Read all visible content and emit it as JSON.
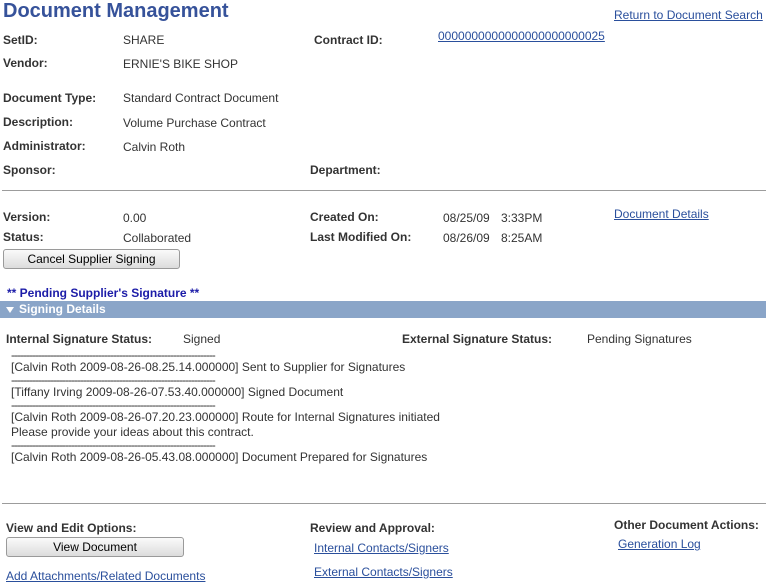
{
  "header": {
    "title": "Document Management",
    "return_link": "Return to Document Search"
  },
  "fields": {
    "setid_label": "SetID:",
    "setid_value": "SHARE",
    "contract_id_label": "Contract ID:",
    "contract_id_value": "0000000000000000000000025",
    "vendor_label": "Vendor:",
    "vendor_value": "ERNIE'S BIKE SHOP",
    "doc_type_label": "Document Type:",
    "doc_type_value": "Standard Contract Document",
    "description_label": "Description:",
    "description_value": "Volume Purchase Contract",
    "administrator_label": "Administrator:",
    "administrator_value": "Calvin Roth",
    "sponsor_label": "Sponsor:",
    "department_label": "Department:"
  },
  "version_section": {
    "version_label": "Version:",
    "version_value": "0.00",
    "status_label": "Status:",
    "status_value": "Collaborated",
    "created_label": "Created On:",
    "created_date": "08/25/09",
    "created_time": "3:33PM",
    "modified_label": "Last Modified On:",
    "modified_date": "08/26/09",
    "modified_time": "8:25AM",
    "document_details_link": "Document Details",
    "cancel_button": "Cancel Supplier Signing",
    "pending_text": "** Pending Supplier's Signature **"
  },
  "signing": {
    "bar_label": "Signing Details",
    "internal_label": "Internal Signature Status:",
    "internal_value": "Signed",
    "external_label": "External Signature Status:",
    "external_value": "Pending Signatures",
    "separator": "--------------------------------------------------------------------",
    "log": [
      {
        "lines": [
          "[Calvin Roth 2009-08-26-08.25.14.000000]  Sent to Supplier for Signatures"
        ]
      },
      {
        "lines": [
          "[Tiffany Irving 2009-08-26-07.53.40.000000]  Signed Document"
        ]
      },
      {
        "lines": [
          "[Calvin Roth 2009-08-26-07.20.23.000000]  Route for Internal Signatures initiated",
          "Please provide your ideas about this contract."
        ]
      },
      {
        "lines": [
          "[Calvin Roth 2009-08-26-05.43.08.000000]  Document Prepared for Signatures"
        ]
      }
    ]
  },
  "footer": {
    "view_edit_label": "View and Edit Options:",
    "view_document_button": "View Document",
    "add_attachments_link": "Add Attachments/Related Documents",
    "review_label": "Review and Approval:",
    "internal_contacts_link": "Internal Contacts/Signers",
    "external_contacts_link": "External Contacts/Signers",
    "other_actions_label": "Other Document Actions:",
    "generation_log_link": "Generation Log"
  }
}
